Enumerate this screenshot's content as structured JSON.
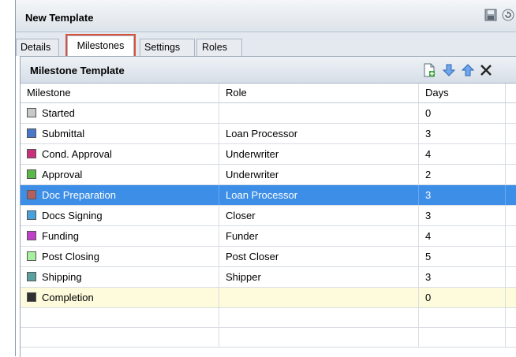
{
  "window": {
    "title": "New Template"
  },
  "tabs": [
    "Details",
    "Milestones",
    "Settings",
    "Roles"
  ],
  "active_tab": "Milestones",
  "panel": {
    "title": "Milestone Template"
  },
  "table": {
    "columns": [
      "Milestone",
      "Role",
      "Days"
    ],
    "rows": [
      {
        "milestone": "Started",
        "role": "",
        "days": "0",
        "color": "#c8c8c8"
      },
      {
        "milestone": "Submittal",
        "role": "Loan Processor",
        "days": "3",
        "color": "#4a78c8"
      },
      {
        "milestone": "Cond. Approval",
        "role": "Underwriter",
        "days": "4",
        "color": "#c8307a"
      },
      {
        "milestone": "Approval",
        "role": "Underwriter",
        "days": "2",
        "color": "#5bb84a"
      },
      {
        "milestone": "Doc Preparation",
        "role": "Loan Processor",
        "days": "3",
        "color": "#b06060"
      },
      {
        "milestone": "Docs Signing",
        "role": "Closer",
        "days": "3",
        "color": "#4aa0d8"
      },
      {
        "milestone": "Funding",
        "role": "Funder",
        "days": "4",
        "color": "#c040c8"
      },
      {
        "milestone": "Post Closing",
        "role": "Post Closer",
        "days": "5",
        "color": "#a8f0a0"
      },
      {
        "milestone": "Shipping",
        "role": "Shipper",
        "days": "3",
        "color": "#5aa0a0"
      },
      {
        "milestone": "Completion",
        "role": "",
        "days": "0",
        "color": "#303030"
      }
    ]
  },
  "selection_color": "#3d8ee7",
  "highlight_color": "#fefbdc",
  "icons": {
    "title_bar": [
      "save-icon",
      "refresh-icon"
    ],
    "panel_toolbar": [
      "new-document-icon",
      "move-down-icon",
      "move-up-icon",
      "delete-icon"
    ]
  }
}
